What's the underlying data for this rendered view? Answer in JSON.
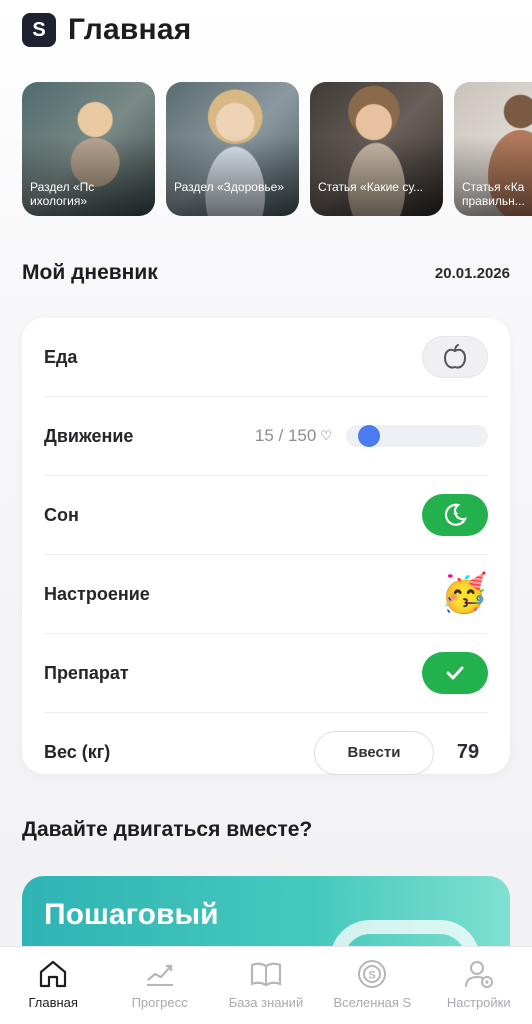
{
  "header": {
    "logo_letter": "S",
    "title": "Главная"
  },
  "stories": [
    {
      "caption": "Раздел «Пс ихология»"
    },
    {
      "caption": "Раздел «Здоровье»"
    },
    {
      "caption": "Статья «Какие су..."
    },
    {
      "caption": "Статья «Ка правильн..."
    }
  ],
  "diary": {
    "title": "Мой дневник",
    "date": "20.01.2026",
    "rows": {
      "food": {
        "label": "Еда",
        "icon": "apple-icon"
      },
      "movement": {
        "label": "Движение",
        "steps": "15 / 150",
        "progress": 0.1
      },
      "sleep": {
        "label": "Сон",
        "icon": "moon-icon"
      },
      "mood": {
        "label": "Настроение",
        "emoji": "🥳"
      },
      "drug": {
        "label": "Препарат",
        "icon": "check-icon"
      },
      "weight": {
        "label": "Вес (кг)",
        "button": "Ввести",
        "value": "79"
      }
    }
  },
  "move": {
    "title": "Давайте двигаться вместе?",
    "promo_text": "Пошаговый"
  },
  "tabbar": {
    "items": [
      {
        "label": "Главная",
        "icon": "home-icon",
        "active": true
      },
      {
        "label": "Прогресс",
        "icon": "chart-icon",
        "active": false
      },
      {
        "label": "База знаний",
        "icon": "book-icon",
        "active": false
      },
      {
        "label": "Вселенная S",
        "icon": "planet-icon",
        "active": false
      },
      {
        "label": "Настройки",
        "icon": "settings-icon",
        "active": false
      }
    ]
  },
  "colors": {
    "green": "#22b14c",
    "blue": "#4a7bf0",
    "accent_teal": "#2fb3b4"
  }
}
